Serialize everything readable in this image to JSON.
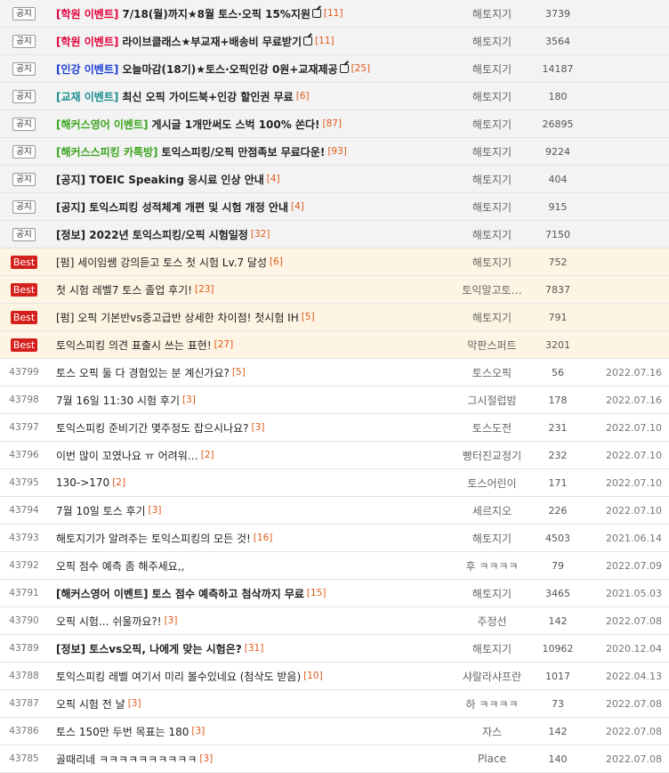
{
  "colors": {
    "notice_bg": "#f3f3f3",
    "best_bg": "#fdf4e3",
    "best_badge": "#d4201c",
    "comment_count": "#e05a18",
    "cat_red": "#e4003b",
    "cat_blue": "#1c3cd6",
    "cat_teal": "#1a8f8f",
    "cat_green": "#3aa41c"
  },
  "posts": [
    {
      "kind": "notice",
      "badge": "공지",
      "cat": "[학원 이벤트]",
      "cat_color": "#e4003b",
      "title": "7/18(월)까지★8월 토스·오픽 15%지원",
      "icon": "edit-icon",
      "comments": "[11]",
      "author": "해토지기",
      "views": "3739",
      "date": "",
      "bold": true
    },
    {
      "kind": "notice",
      "badge": "공지",
      "cat": "[학원 이벤트]",
      "cat_color": "#e4003b",
      "title": "라이브클래스★부교재+배송비 무료받기",
      "icon": "edit-icon",
      "comments": "[11]",
      "author": "해토지기",
      "views": "3564",
      "date": "",
      "bold": true
    },
    {
      "kind": "notice",
      "badge": "공지",
      "cat": "[인강 이벤트]",
      "cat_color": "#1c3cd6",
      "title": "오늘마감(18기)★토스·오픽인강 0원+교재제공",
      "icon": "edit-icon",
      "comments": "[25]",
      "author": "해토지기",
      "views": "14187",
      "date": "",
      "bold": true
    },
    {
      "kind": "notice",
      "badge": "공지",
      "cat": "[교재 이벤트]",
      "cat_color": "#1a8f8f",
      "title": "최신 오픽 가이드북+인강 할인권 무료",
      "icon": "",
      "comments": "[6]",
      "author": "해토지기",
      "views": "180",
      "date": "",
      "bold": true
    },
    {
      "kind": "notice",
      "badge": "공지",
      "cat": "[해커스영어 이벤트]",
      "cat_color": "#3aa41c",
      "title": "게시글 1개만써도 스벅 100% 쏜다!",
      "icon": "",
      "comments": "[87]",
      "author": "해토지기",
      "views": "26895",
      "date": "",
      "bold": true
    },
    {
      "kind": "notice",
      "badge": "공지",
      "cat": "[해커스스피킹 카톡방]",
      "cat_color": "#3aa41c",
      "title": "토익스피킹/오픽 만점족보 무료다운!",
      "icon": "",
      "comments": "[93]",
      "author": "해토지기",
      "views": "9224",
      "date": "",
      "bold": true
    },
    {
      "kind": "notice",
      "badge": "공지",
      "cat": "",
      "cat_color": "#222222",
      "title": "[공지] TOEIC Speaking 응시료 인상 안내",
      "icon": "",
      "comments": "[4]",
      "author": "해토지기",
      "views": "404",
      "date": "",
      "bold": true
    },
    {
      "kind": "notice",
      "badge": "공지",
      "cat": "",
      "cat_color": "#222222",
      "title": "[공지] 토익스피킹 성적체계 개편 및 시험 개정 안내",
      "icon": "",
      "comments": "[4]",
      "author": "해토지기",
      "views": "915",
      "date": "",
      "bold": true
    },
    {
      "kind": "notice",
      "badge": "공지",
      "cat": "",
      "cat_color": "#222222",
      "title": "[정보] 2022년 토익스피킹/오픽 시험일정",
      "icon": "",
      "comments": "[32]",
      "author": "해토지기",
      "views": "7150",
      "date": "",
      "bold": true
    },
    {
      "kind": "best",
      "badge": "Best",
      "cat": "",
      "cat_color": "#222222",
      "title": "[펌] 세이임쌤 강의듣고 토스 첫 시험 Lv.7 달성",
      "icon": "",
      "comments": "[6]",
      "author": "해토지기",
      "views": "752",
      "date": "",
      "bold": false
    },
    {
      "kind": "best",
      "badge": "Best",
      "cat": "",
      "cat_color": "#222222",
      "title": "첫 시험 레벨7 토스 졸업 후기!",
      "icon": "",
      "comments": "[23]",
      "author": "토익말고토…",
      "views": "7837",
      "date": "",
      "bold": false
    },
    {
      "kind": "best",
      "badge": "Best",
      "cat": "",
      "cat_color": "#222222",
      "title": "[펌] 오픽 기본반vs중고급반 상세한 차이점! 첫시험 IH",
      "icon": "",
      "comments": "[5]",
      "author": "해토지기",
      "views": "791",
      "date": "",
      "bold": false
    },
    {
      "kind": "best",
      "badge": "Best",
      "cat": "",
      "cat_color": "#222222",
      "title": "토익스피킹 의견 표출시 쓰는 표현!",
      "icon": "",
      "comments": "[27]",
      "author": "막판스퍼트",
      "views": "3201",
      "date": "",
      "bold": false
    },
    {
      "kind": "normal",
      "badge": "43799",
      "cat": "",
      "cat_color": "#222222",
      "title": "토스 오픽 둘 다 경험있는 분 계신가요?",
      "icon": "",
      "comments": "[5]",
      "author": "토스오픽",
      "views": "56",
      "date": "2022.07.16",
      "bold": false
    },
    {
      "kind": "normal",
      "badge": "43798",
      "cat": "",
      "cat_color": "#222222",
      "title": "7월 16일 11:30 시험 후기",
      "icon": "",
      "comments": "[3]",
      "author": "그시절럽밤",
      "views": "178",
      "date": "2022.07.16",
      "bold": false
    },
    {
      "kind": "normal",
      "badge": "43797",
      "cat": "",
      "cat_color": "#222222",
      "title": "토익스피킹 준비기간 몇주정도 잡으시나요?",
      "icon": "",
      "comments": "[3]",
      "author": "토스도전",
      "views": "231",
      "date": "2022.07.10",
      "bold": false
    },
    {
      "kind": "normal",
      "badge": "43796",
      "cat": "",
      "cat_color": "#222222",
      "title": "이번 많이 꼬였나요 ㅠ 어려워…",
      "icon": "",
      "comments": "[2]",
      "author": "빵터진교정기",
      "views": "232",
      "date": "2022.07.10",
      "bold": false
    },
    {
      "kind": "normal",
      "badge": "43795",
      "cat": "",
      "cat_color": "#222222",
      "title": "130->170",
      "icon": "",
      "comments": "[2]",
      "author": "토스어린이",
      "views": "171",
      "date": "2022.07.10",
      "bold": false
    },
    {
      "kind": "normal",
      "badge": "43794",
      "cat": "",
      "cat_color": "#222222",
      "title": "7월 10일 토스 후기",
      "icon": "",
      "comments": "[3]",
      "author": "세르지오",
      "views": "226",
      "date": "2022.07.10",
      "bold": false
    },
    {
      "kind": "normal",
      "badge": "43793",
      "cat": "",
      "cat_color": "#222222",
      "title": "해토지기가 알려주는 토익스피킹의 모든 것!",
      "icon": "",
      "comments": "[16]",
      "author": "해토지기",
      "views": "4503",
      "date": "2021.06.14",
      "bold": false
    },
    {
      "kind": "normal",
      "badge": "43792",
      "cat": "",
      "cat_color": "#222222",
      "title": "오픽 점수 예측 좀 해주세요,,",
      "icon": "",
      "comments": "",
      "author": "후 ㅋㅋㅋㅋ",
      "views": "79",
      "date": "2022.07.09",
      "bold": false
    },
    {
      "kind": "normal",
      "badge": "43791",
      "cat": "",
      "cat_color": "#222222",
      "title": "[해커스영어 이벤트] 토스 점수 예측하고 첨삭까지 무료",
      "icon": "",
      "comments": "[15]",
      "author": "해토지기",
      "views": "3465",
      "date": "2021.05.03",
      "bold": true
    },
    {
      "kind": "normal",
      "badge": "43790",
      "cat": "",
      "cat_color": "#222222",
      "title": "오픽 시험... 쉬울까요?!",
      "icon": "",
      "comments": "[3]",
      "author": "주정선",
      "views": "142",
      "date": "2022.07.08",
      "bold": false
    },
    {
      "kind": "normal",
      "badge": "43789",
      "cat": "",
      "cat_color": "#222222",
      "title": "[정보] 토스vs오픽, 나에게 맞는 시험은?",
      "icon": "",
      "comments": "[31]",
      "author": "해토지기",
      "views": "10962",
      "date": "2020.12.04",
      "bold": true
    },
    {
      "kind": "normal",
      "badge": "43788",
      "cat": "",
      "cat_color": "#222222",
      "title": "토익스피킹 레벨 여기서 미리 볼수있네요 (첨삭도 받음)",
      "icon": "",
      "comments": "[10]",
      "author": "샤랄라샤프란",
      "views": "1017",
      "date": "2022.04.13",
      "bold": false
    },
    {
      "kind": "normal",
      "badge": "43787",
      "cat": "",
      "cat_color": "#222222",
      "title": "오픽 시험 전 날",
      "icon": "",
      "comments": "[3]",
      "author": "하 ㅋㅋㅋㅋ",
      "views": "73",
      "date": "2022.07.08",
      "bold": false
    },
    {
      "kind": "normal",
      "badge": "43786",
      "cat": "",
      "cat_color": "#222222",
      "title": "토스 150만 두번 목표는 180",
      "icon": "",
      "comments": "[3]",
      "author": "자스",
      "views": "142",
      "date": "2022.07.08",
      "bold": false
    },
    {
      "kind": "normal",
      "badge": "43785",
      "cat": "",
      "cat_color": "#222222",
      "title": "골때리네 ㅋㅋㅋㅋㅋㅋㅋㅋㅋㅋ",
      "icon": "",
      "comments": "[3]",
      "author": "Place",
      "views": "140",
      "date": "2022.07.08",
      "bold": false
    }
  ]
}
